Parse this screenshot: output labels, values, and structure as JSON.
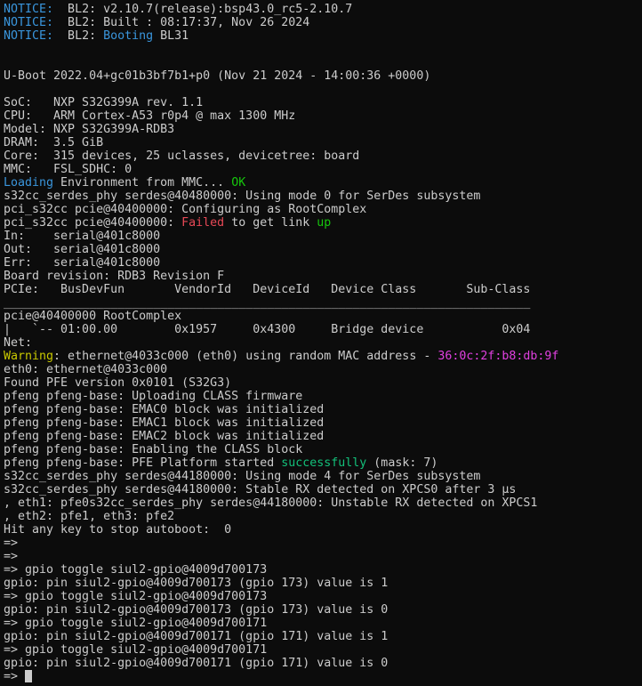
{
  "colors": {
    "default": "#cccccc",
    "cyan": "#3a96dd",
    "green": "#16c60c",
    "teal": "#13c07a",
    "red": "#e74856",
    "yellow": "#c8c800",
    "magenta": "#e040e0"
  },
  "lines": [
    [
      {
        "t": "NOTICE:",
        "c": "cyan"
      },
      {
        "t": "  BL2: v2.10.7(release):bsp43.0_rc5-2.10.7"
      }
    ],
    [
      {
        "t": "NOTICE:",
        "c": "cyan"
      },
      {
        "t": "  BL2: Built : 08:17:37, Nov 26 2024"
      }
    ],
    [
      {
        "t": "NOTICE:",
        "c": "cyan"
      },
      {
        "t": "  BL2: "
      },
      {
        "t": "Booting",
        "c": "cyan"
      },
      {
        "t": " BL31"
      }
    ],
    [],
    [],
    [
      {
        "t": "U-Boot 2022.04+gc01b3bf7b1+p0 (Nov 21 2024 - 14:00:36 +0000)"
      }
    ],
    [],
    [
      {
        "t": "SoC:   NXP S32G399A rev. 1.1"
      }
    ],
    [
      {
        "t": "CPU:   ARM Cortex-A53 r0p4 @ max 1300 MHz"
      }
    ],
    [
      {
        "t": "Model: NXP S32G399A-RDB3"
      }
    ],
    [
      {
        "t": "DRAM:  3.5 GiB"
      }
    ],
    [
      {
        "t": "Core:  315 devices, 25 uclasses, devicetree: board"
      }
    ],
    [
      {
        "t": "MMC:   FSL_SDHC: 0"
      }
    ],
    [
      {
        "t": "Loading",
        "c": "cyan"
      },
      {
        "t": " Environment from MMC... "
      },
      {
        "t": "OK",
        "c": "green"
      }
    ],
    [
      {
        "t": "s32cc_serdes_phy serdes@40480000: Using mode 0 for SerDes subsystem"
      }
    ],
    [
      {
        "t": "pci_s32cc pcie@40400000: Configuring as RootComplex"
      }
    ],
    [
      {
        "t": "pci_s32cc pcie@40400000: "
      },
      {
        "t": "Failed",
        "c": "red"
      },
      {
        "t": " to get link "
      },
      {
        "t": "up",
        "c": "green"
      }
    ],
    [
      {
        "t": "In:    serial@401c8000"
      }
    ],
    [
      {
        "t": "Out:   serial@401c8000"
      }
    ],
    [
      {
        "t": "Err:   serial@401c8000"
      }
    ],
    [
      {
        "t": "Board revision: RDB3 Revision F"
      }
    ],
    [
      {
        "t": "PCIe:   BusDevFun       VendorId   DeviceId   Device Class       Sub-Class"
      }
    ],
    [
      {
        "t": "__________________________________________________________________________"
      }
    ],
    [
      {
        "t": "pcie@40400000 RootComplex"
      }
    ],
    [
      {
        "t": "|   `-- 01:00.00        0x1957     0x4300     Bridge device           0x04"
      }
    ],
    [
      {
        "t": "Net:"
      }
    ],
    [
      {
        "t": "Warning",
        "c": "yellow"
      },
      {
        "t": ": ethernet@4033c000 (eth0) using random MAC address - "
      },
      {
        "t": "36:0c:2f:b8:db:9f",
        "c": "magenta"
      }
    ],
    [
      {
        "t": "eth0: ethernet@4033c000"
      }
    ],
    [
      {
        "t": "Found PFE version 0x0101 (S32G3)"
      }
    ],
    [
      {
        "t": "pfeng pfeng-base: Uploading CLASS firmware"
      }
    ],
    [
      {
        "t": "pfeng pfeng-base: EMAC0 block was initialized"
      }
    ],
    [
      {
        "t": "pfeng pfeng-base: EMAC1 block was initialized"
      }
    ],
    [
      {
        "t": "pfeng pfeng-base: EMAC2 block was initialized"
      }
    ],
    [
      {
        "t": "pfeng pfeng-base: Enabling the CLASS block"
      }
    ],
    [
      {
        "t": "pfeng pfeng-base: PFE Platform started "
      },
      {
        "t": "successfully",
        "c": "teal"
      },
      {
        "t": " (mask: 7)"
      }
    ],
    [
      {
        "t": "s32cc_serdes_phy serdes@44180000: Using mode 4 for SerDes subsystem"
      }
    ],
    [
      {
        "t": "s32cc_serdes_phy serdes@44180000: Stable RX detected on XPCS0 after 3 µs"
      }
    ],
    [
      {
        "t": ", eth1: pfe0s32cc_serdes_phy serdes@44180000: Unstable RX detected on XPCS1"
      }
    ],
    [
      {
        "t": ", eth2: pfe1, eth3: pfe2"
      }
    ],
    [
      {
        "t": "Hit any key to stop autoboot:  0"
      }
    ],
    [
      {
        "t": "=>"
      }
    ],
    [
      {
        "t": "=>"
      }
    ],
    [
      {
        "t": "=> gpio toggle siul2-gpio@4009d700173"
      }
    ],
    [
      {
        "t": "gpio: pin siul2-gpio@4009d700173 (gpio 173) value is 1"
      }
    ],
    [
      {
        "t": "=> gpio toggle siul2-gpio@4009d700173"
      }
    ],
    [
      {
        "t": "gpio: pin siul2-gpio@4009d700173 (gpio 173) value is 0"
      }
    ],
    [
      {
        "t": "=> gpio toggle siul2-gpio@4009d700171"
      }
    ],
    [
      {
        "t": "gpio: pin siul2-gpio@4009d700171 (gpio 171) value is 1"
      }
    ],
    [
      {
        "t": "=> gpio toggle siul2-gpio@4009d700171"
      }
    ],
    [
      {
        "t": "gpio: pin siul2-gpio@4009d700171 (gpio 171) value is 0"
      }
    ],
    [
      {
        "t": "=> "
      }
    ]
  ]
}
